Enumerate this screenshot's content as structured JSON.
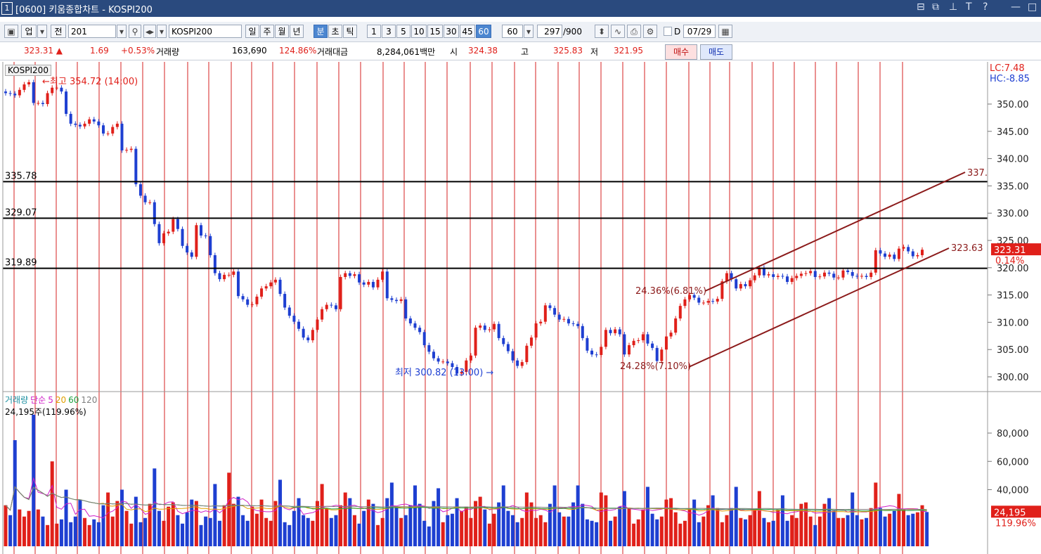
{
  "window": {
    "number": "1",
    "title": "[0600] 키움종합차트 - KOSPI200",
    "controls": [
      "⊟",
      "⧉",
      "⊥",
      "T",
      "?",
      "—",
      "□"
    ]
  },
  "toolbar": {
    "category": "업",
    "scope": "전",
    "code": "201",
    "name": "KOSPI200",
    "periods": [
      "일",
      "주",
      "월",
      "년",
      "분",
      "초",
      "틱"
    ],
    "active_period": "분",
    "intervals": [
      "1",
      "3",
      "5",
      "10",
      "15",
      "30",
      "45",
      "60"
    ],
    "active_interval": "60",
    "interval_select": "60",
    "count": "297",
    "count_total": "/900",
    "date_flag": "D",
    "date": "07/29"
  },
  "quote": {
    "price": "323.31 ▲",
    "change": "1.69",
    "change_pct": "+0.53%",
    "volume_label": "거래량",
    "volume": "163,690",
    "volume_pct": "124.86%",
    "amount_label": "거래대금",
    "amount": "8,284,061백만",
    "open_label": "시",
    "open": "324.38",
    "high_label": "고",
    "high": "325.83",
    "low_label": "저",
    "low": "321.95",
    "buy_label": "매수",
    "sell_label": "매도"
  },
  "price_panel": {
    "title": "KOSPI200",
    "lc": "LC:7.48",
    "hc": "HC:-8.85",
    "ticks": [
      300,
      305,
      310,
      315,
      320,
      325,
      330,
      335,
      340,
      345,
      350
    ],
    "tick_labels": [
      "300.00",
      "305.00",
      "310.00",
      "315.00",
      "320.00",
      "325.00",
      "330.00",
      "335.00",
      "340.00",
      "345.00",
      "350.00"
    ],
    "hlines": [
      {
        "value": 335.78,
        "label": "335.78"
      },
      {
        "value": 329.07,
        "label": "329.07"
      },
      {
        "value": 319.89,
        "label": "319.89"
      }
    ],
    "current_label": "323.31",
    "current_pct": "0.14%",
    "high_note": "최고 354.72 (14:00)",
    "low_note": "최저 300.82 (13:00)",
    "ann_upper": "24.36%(6.81%)",
    "ann_lower": "24.28%(7.10%)",
    "ch_upper_label": "337.",
    "ch_lower_label": "323.63"
  },
  "volume_panel": {
    "legend": [
      "거래량",
      "단순",
      "5",
      "20",
      "60",
      "120"
    ],
    "legend_colors": [
      "#1a8fa0",
      "#d020c8",
      "#d020c8",
      "#e0a000",
      "#20a040",
      "#808080"
    ],
    "value_text": "24,195주(119.96%)",
    "ticks": [
      40000,
      60000,
      80000
    ],
    "tick_labels": [
      "40,000",
      "60,000",
      "80,000"
    ],
    "current_label": "24,195",
    "current_pct": "119.96%"
  },
  "colors": {
    "up": "#e0201a",
    "down": "#1e3fd1",
    "vline": "#d62020",
    "channel": "#8b1a1a",
    "hline": "#000000"
  },
  "chart_data": {
    "type": "candlestick",
    "price_closes": [
      352.0,
      351.9,
      351.6,
      352.6,
      353.6,
      354.0,
      350.2,
      350.2,
      350.0,
      352.0,
      353.0,
      353.0,
      352.3,
      348.2,
      346.4,
      346.2,
      345.9,
      346.4,
      347.2,
      346.8,
      346.1,
      344.6,
      344.6,
      345.8,
      346.4,
      341.5,
      341.6,
      341.8,
      335.3,
      333.2,
      332.0,
      332.0,
      328.0,
      324.5,
      326.3,
      326.6,
      328.9,
      327.1,
      324.0,
      322.8,
      322.0,
      327.8,
      325.9,
      325.8,
      322.3,
      319.0,
      317.9,
      318.7,
      318.7,
      319.3,
      314.8,
      314.2,
      313.2,
      313.3,
      314.7,
      316.2,
      316.6,
      317.3,
      317.8,
      315.2,
      312.7,
      311.2,
      310.1,
      308.8,
      307.2,
      306.7,
      308.6,
      310.5,
      312.4,
      313.2,
      313.1,
      312.4,
      318.3,
      319.0,
      318.5,
      318.8,
      317.3,
      316.9,
      317.4,
      316.4,
      317.8,
      319.3,
      314.4,
      314.1,
      313.9,
      314.2,
      310.7,
      309.8,
      309.0,
      308.2,
      305.8,
      304.6,
      303.4,
      302.8,
      302.8,
      302.5,
      301.8,
      300.6,
      300.9,
      303.0,
      303.9,
      309.0,
      309.4,
      308.6,
      308.7,
      309.7,
      307.1,
      306.0,
      304.7,
      303.0,
      302.0,
      302.7,
      305.7,
      307.2,
      309.8,
      310.1,
      313.1,
      312.6,
      311.4,
      310.5,
      310.6,
      309.8,
      309.7,
      309.3,
      307.1,
      304.8,
      304.1,
      304.0,
      305.5,
      308.6,
      308.0,
      308.7,
      307.8,
      304.1,
      305.8,
      306.6,
      306.7,
      307.8,
      306.1,
      305.3,
      302.9,
      305.0,
      307.4,
      308.1,
      310.7,
      313.0,
      314.2,
      315.0,
      314.5,
      313.6,
      313.6,
      313.9,
      313.8,
      314.3,
      317.5,
      319.0,
      317.9,
      316.2,
      317.0,
      316.6,
      317.7,
      318.6,
      320.0,
      318.6,
      318.8,
      318.3,
      318.5,
      318.4,
      317.4,
      318.1,
      318.5,
      318.9,
      319.0,
      319.4,
      318.3,
      318.4,
      319.1,
      318.9,
      318.2,
      318.2,
      319.5,
      319.2,
      318.5,
      318.4,
      318.5,
      318.3,
      319.1,
      323.2,
      322.6,
      322.0,
      322.4,
      321.6,
      323.5,
      323.8,
      323.0,
      322.1,
      322.3,
      323.3
    ],
    "price_range": [
      299,
      357
    ],
    "volume_range": [
      0,
      100000
    ],
    "volumes": [
      29000,
      22000,
      75000,
      26000,
      21000,
      25000,
      93000,
      26000,
      21000,
      15000,
      60000,
      16000,
      19000,
      40000,
      17000,
      21000,
      33000,
      20000,
      15000,
      19000,
      17000,
      29000,
      38000,
      21000,
      32000,
      40000,
      25000,
      16000,
      35000,
      17000,
      20000,
      30000,
      55000,
      25000,
      18000,
      28000,
      31000,
      22000,
      16000,
      24000,
      33000,
      32000,
      15000,
      21000,
      20000,
      44000,
      18000,
      29000,
      52000,
      30000,
      35000,
      22000,
      18000,
      28000,
      23000,
      33000,
      20000,
      18000,
      32000,
      47000,
      17000,
      15000,
      25000,
      34000,
      22000,
      20000,
      18000,
      32000,
      44000,
      27000,
      20000,
      22000,
      29000,
      38000,
      34000,
      22000,
      16000,
      25000,
      33000,
      30000,
      15000,
      20000,
      34000,
      45000,
      28000,
      20000,
      22000,
      29000,
      43000,
      30000,
      18000,
      14000,
      32000,
      41000,
      17000,
      22000,
      23000,
      34000,
      25000,
      28000,
      20000,
      32000,
      35000,
      26000,
      16000,
      23000,
      31000,
      43000,
      25000,
      22000,
      17000,
      20000,
      38000,
      31000,
      20000,
      22000,
      17000,
      30000,
      43000,
      24000,
      21000,
      21000,
      31000,
      43000,
      30000,
      19000,
      18000,
      17000,
      38000,
      36000,
      18000,
      21000,
      28000,
      39000,
      27000,
      16000,
      19000,
      26000,
      42000,
      23000,
      19000,
      21000,
      33000,
      34000,
      24000,
      16000,
      18000,
      26000,
      33000,
      17000,
      21000,
      29000,
      36000,
      27000,
      17000,
      22000,
      27000,
      42000,
      20000,
      19000,
      22000,
      26000,
      39000,
      20000,
      17000,
      18000,
      26000,
      36000,
      18000,
      22000,
      20000,
      30000,
      31000,
      21000,
      15000,
      21000,
      30000,
      34000,
      25000,
      20000,
      20000,
      22000,
      38000,
      22000,
      19000,
      20000,
      27000,
      45000,
      27000,
      21000,
      23000,
      25000,
      37000,
      26000,
      22000,
      23000,
      24000,
      29000,
      24195
    ]
  }
}
